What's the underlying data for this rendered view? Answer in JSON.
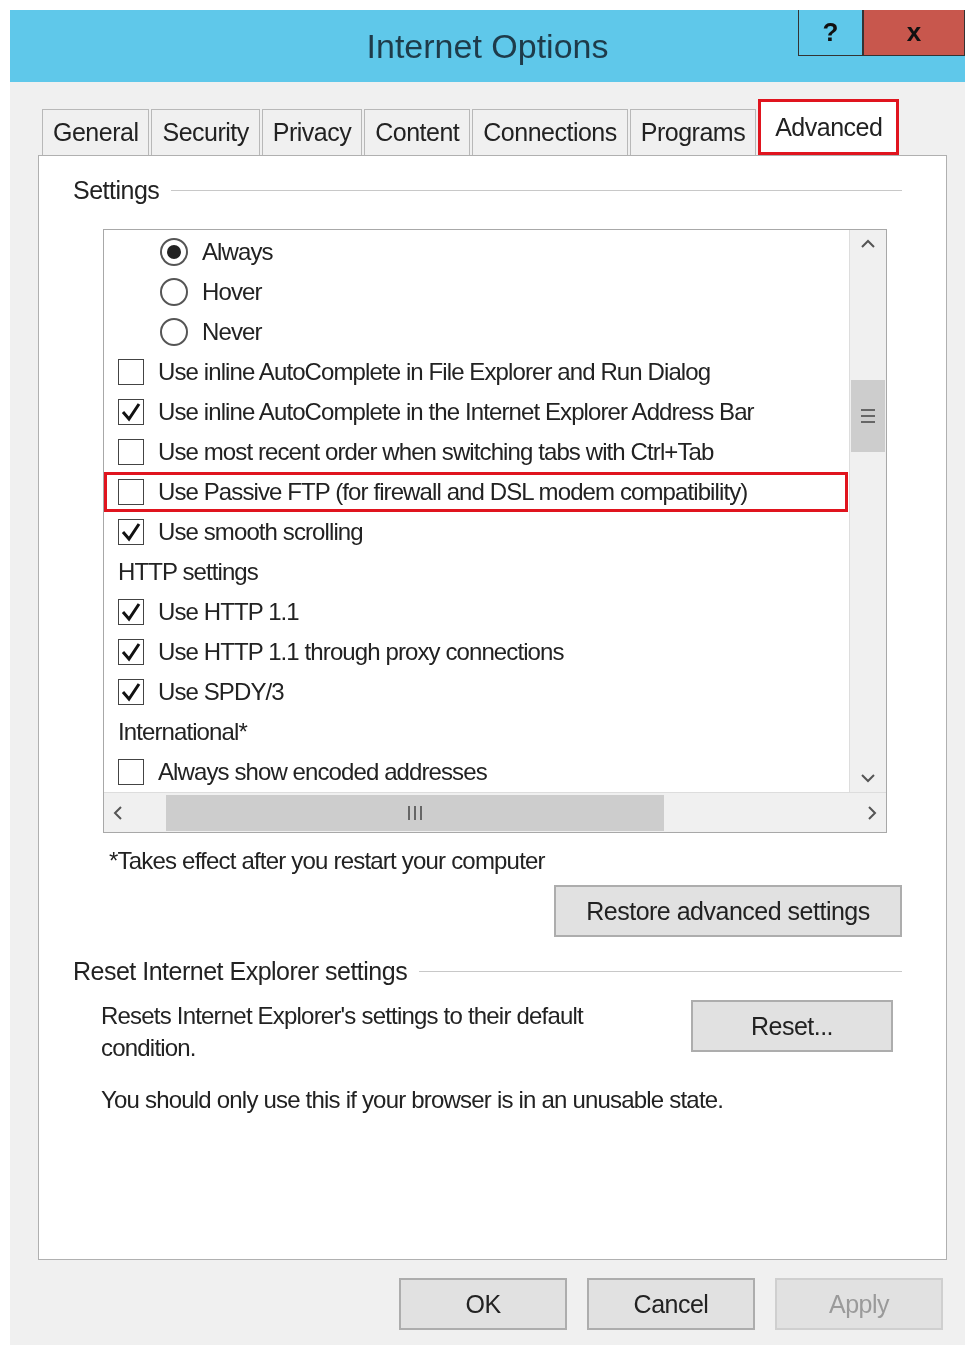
{
  "window": {
    "title": "Internet Options",
    "help_button": "?",
    "close_button": "x"
  },
  "tabs": [
    {
      "label": "General",
      "selected": false,
      "highlighted": false
    },
    {
      "label": "Security",
      "selected": false,
      "highlighted": false
    },
    {
      "label": "Privacy",
      "selected": false,
      "highlighted": false
    },
    {
      "label": "Content",
      "selected": false,
      "highlighted": false
    },
    {
      "label": "Connections",
      "selected": false,
      "highlighted": false
    },
    {
      "label": "Programs",
      "selected": false,
      "highlighted": false
    },
    {
      "label": "Advanced",
      "selected": true,
      "highlighted": true
    }
  ],
  "settings": {
    "heading": "Settings",
    "items": [
      {
        "kind": "radio",
        "label": "Always",
        "selected": true
      },
      {
        "kind": "radio",
        "label": "Hover",
        "selected": false
      },
      {
        "kind": "radio",
        "label": "Never",
        "selected": false
      },
      {
        "kind": "checkbox",
        "label": "Use inline AutoComplete in File Explorer and Run Dialog",
        "checked": false,
        "highlighted": false
      },
      {
        "kind": "checkbox",
        "label": "Use inline AutoComplete in the Internet Explorer Address Bar",
        "checked": true,
        "highlighted": false
      },
      {
        "kind": "checkbox",
        "label": "Use most recent order when switching tabs with Ctrl+Tab",
        "checked": false,
        "highlighted": false
      },
      {
        "kind": "checkbox",
        "label": "Use Passive FTP (for firewall and DSL modem compatibility)",
        "checked": false,
        "highlighted": true
      },
      {
        "kind": "checkbox",
        "label": "Use smooth scrolling",
        "checked": true,
        "highlighted": false
      },
      {
        "kind": "heading",
        "label": "HTTP settings"
      },
      {
        "kind": "checkbox",
        "label": "Use HTTP 1.1",
        "checked": true,
        "highlighted": false
      },
      {
        "kind": "checkbox",
        "label": "Use HTTP 1.1 through proxy connections",
        "checked": true,
        "highlighted": false
      },
      {
        "kind": "checkbox",
        "label": "Use SPDY/3",
        "checked": true,
        "highlighted": false
      },
      {
        "kind": "heading",
        "label": "International*"
      },
      {
        "kind": "checkbox",
        "label": "Always show encoded addresses",
        "checked": false,
        "highlighted": false
      }
    ],
    "note": "*Takes effect after you restart your computer",
    "restore_button": "Restore advanced settings"
  },
  "reset": {
    "heading": "Reset Internet Explorer settings",
    "description": "Resets Internet Explorer's settings to their default condition.",
    "reset_button": "Reset...",
    "warning": "You should only use this if your browser is in an unusable state."
  },
  "buttons": [
    {
      "label": "OK",
      "disabled": false
    },
    {
      "label": "Cancel",
      "disabled": false
    },
    {
      "label": "Apply",
      "disabled": true
    }
  ]
}
